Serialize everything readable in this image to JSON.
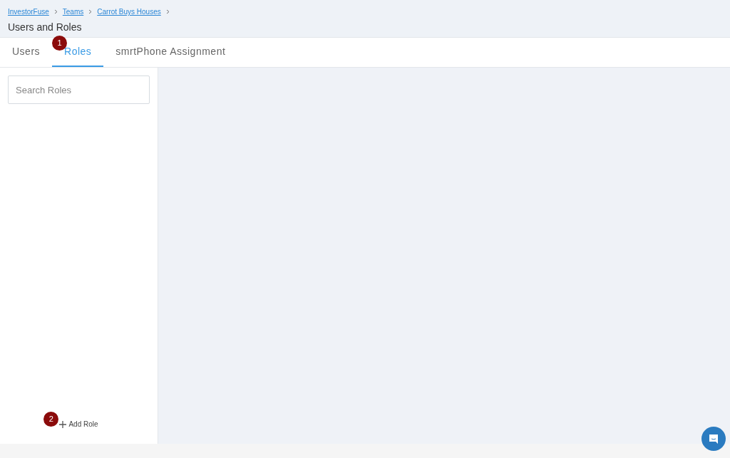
{
  "breadcrumbs": [
    "InvestorFuse",
    "Teams",
    "Carrot Buys Houses"
  ],
  "page_title": "Users and Roles",
  "tabs": [
    {
      "label": "Users",
      "selected": false
    },
    {
      "label": "Roles",
      "selected": true,
      "marker": "1"
    },
    {
      "label": "smrtPhone Assignment",
      "selected": false
    }
  ],
  "search": {
    "placeholder": "Search Roles"
  },
  "add_button": {
    "label": "Add Role",
    "marker": "2"
  }
}
